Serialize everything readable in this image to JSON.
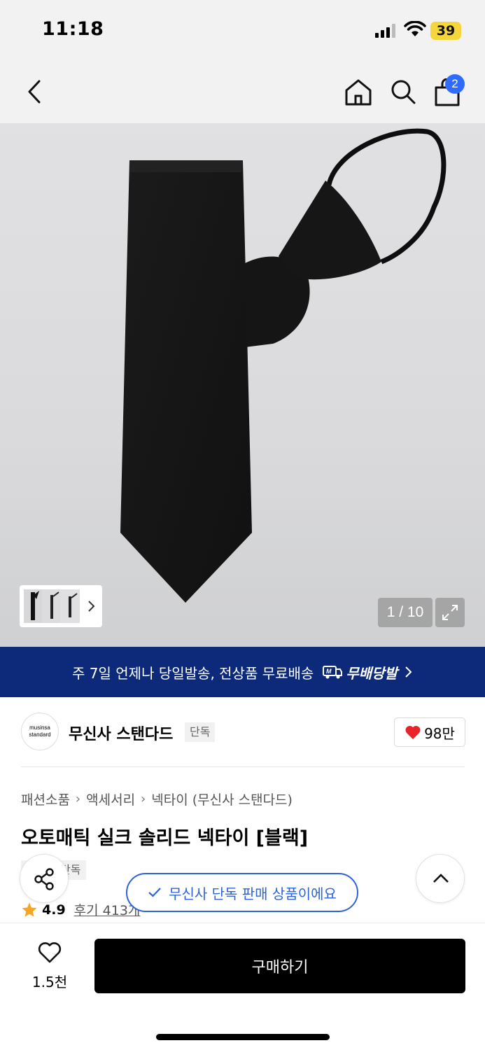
{
  "status_bar": {
    "time": "11:18",
    "battery": "39"
  },
  "nav": {
    "cart_count": "2"
  },
  "gallery": {
    "page_counter": "1 / 10"
  },
  "promo": {
    "text": "주 7일 언제나 당일발송, 전상품 무료배송",
    "logo_text": "무배당발"
  },
  "brand": {
    "logo_line1": "musinsa",
    "logo_line2": "standard",
    "name": "무신사 스탠다드",
    "tag": "단독",
    "like_count": "98만"
  },
  "product": {
    "breadcrumb": [
      "패션소품",
      "액세서리",
      "넥타이 (무신사 스탠다드)"
    ],
    "title": "오토매틱 실크 솔리드 넥타이 [블랙]",
    "exclusive_tag": "단독",
    "rating": "4.9",
    "reviews": "후기 413개"
  },
  "toast": {
    "text": "무신사 단독 판매 상품이에요"
  },
  "bottom_bar": {
    "wish_count": "1.5천",
    "buy_label": "구매하기"
  },
  "colors": {
    "promo_bg": "#0d2a7a",
    "accent_blue": "#2c63d6",
    "badge_blue": "#2f6bff",
    "heart_red": "#e8232a",
    "star_orange": "#f5a623"
  }
}
